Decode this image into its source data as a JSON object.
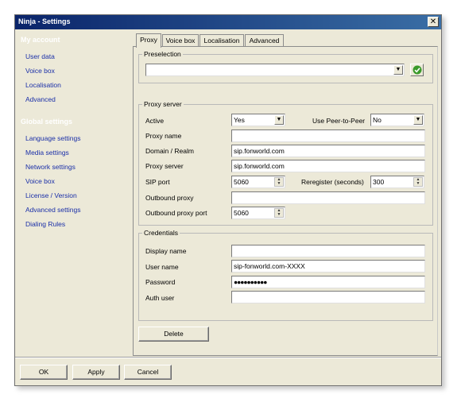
{
  "window": {
    "title": "Ninja - Settings",
    "close_glyph": "✕"
  },
  "sidebar": {
    "my_account_header": "My account",
    "my_account_items": [
      "User data",
      "Voice box",
      "Localisation",
      "Advanced"
    ],
    "global_header": "Global settings",
    "global_items": [
      "Language settings",
      "Media settings",
      "Network settings",
      "Voice box",
      "License / Version",
      "Advanced settings",
      "Dialing Rules"
    ]
  },
  "tabs": [
    "Proxy",
    "Voice box",
    "Localisation",
    "Advanced"
  ],
  "active_tab": "Proxy",
  "preselection": {
    "label": "Preselection",
    "value": ""
  },
  "proxy_server": {
    "label": "Proxy server",
    "active_label": "Active",
    "active_value": "Yes",
    "peer_label": "Use Peer-to-Peer",
    "peer_value": "No",
    "proxy_name_label": "Proxy name",
    "proxy_name_value": "",
    "domain_label": "Domain / Realm",
    "domain_value": "sip.fonworld.com",
    "proxy_server_label": "Proxy server",
    "proxy_server_value": "sip.fonworld.com",
    "sip_port_label": "SIP port",
    "sip_port_value": "5060",
    "reregister_label": "Reregister (seconds)",
    "reregister_value": "300",
    "outbound_proxy_label": "Outbound proxy",
    "outbound_proxy_value": "",
    "outbound_port_label": "Outbound proxy port",
    "outbound_port_value": "5060"
  },
  "credentials": {
    "label": "Credentials",
    "display_name_label": "Display name",
    "display_name_value": "",
    "user_name_label": "User name",
    "user_name_value": "sip-fonworld.com-XXXX",
    "password_label": "Password",
    "password_value": "●●●●●●●●●●",
    "auth_user_label": "Auth user",
    "auth_user_value": ""
  },
  "buttons": {
    "delete": "Delete",
    "ok": "OK",
    "apply": "Apply",
    "cancel": "Cancel"
  },
  "colors": {
    "titlebar": "#0a246a",
    "link": "#1a2fa8",
    "face": "#ece9d8",
    "check": "#3a9a2a"
  }
}
